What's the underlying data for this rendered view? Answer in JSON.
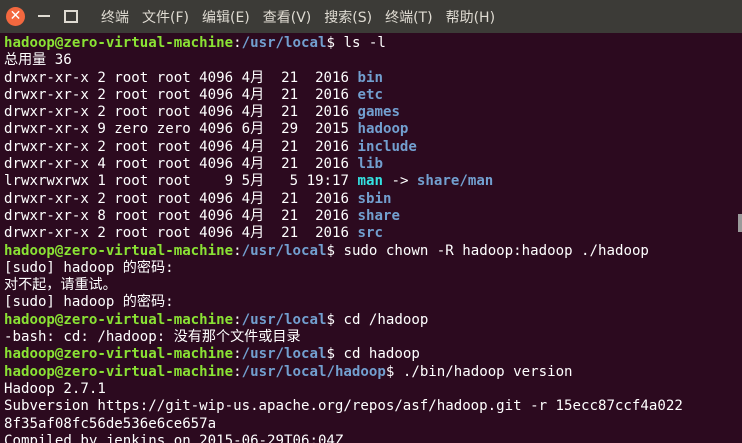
{
  "window": {
    "close_glyph": "✕",
    "menu": [
      "终端",
      "文件(F)",
      "编辑(E)",
      "查看(V)",
      "搜索(S)",
      "终端(T)",
      "帮助(H)"
    ]
  },
  "terminal": {
    "user_host": "hadoop@zero-virtual-machine",
    "colors": {
      "user": "#8ae234",
      "path": "#729fcf",
      "dir": "#729fcf",
      "link": "#34e2e2",
      "bg": "#2c0a1f",
      "fg": "#ffffff"
    },
    "lines": [
      {
        "type": "prompt",
        "path": "/usr/local",
        "cmd": " ls -l"
      },
      {
        "type": "out",
        "text": "总用量 36"
      },
      {
        "type": "ls",
        "meta": "drwxr-xr-x 2 root root 4096 4月  21  2016 ",
        "name": "bin"
      },
      {
        "type": "ls",
        "meta": "drwxr-xr-x 2 root root 4096 4月  21  2016 ",
        "name": "etc"
      },
      {
        "type": "ls",
        "meta": "drwxr-xr-x 2 root root 4096 4月  21  2016 ",
        "name": "games"
      },
      {
        "type": "ls",
        "meta": "drwxr-xr-x 9 zero zero 4096 6月  29  2015 ",
        "name": "hadoop"
      },
      {
        "type": "ls",
        "meta": "drwxr-xr-x 2 root root 4096 4月  21  2016 ",
        "name": "include"
      },
      {
        "type": "ls",
        "meta": "drwxr-xr-x 4 root root 4096 4月  21  2016 ",
        "name": "lib"
      },
      {
        "type": "link",
        "meta": "lrwxrwxrwx 1 root root    9 5月   5 19:17 ",
        "name": "man",
        "arrow": " -> ",
        "target": "share/man"
      },
      {
        "type": "ls",
        "meta": "drwxr-xr-x 2 root root 4096 4月  21  2016 ",
        "name": "sbin"
      },
      {
        "type": "ls",
        "meta": "drwxr-xr-x 8 root root 4096 4月  21  2016 ",
        "name": "share"
      },
      {
        "type": "ls",
        "meta": "drwxr-xr-x 2 root root 4096 4月  21  2016 ",
        "name": "src"
      },
      {
        "type": "prompt",
        "path": "/usr/local",
        "cmd": " sudo chown -R hadoop:hadoop ./hadoop"
      },
      {
        "type": "out",
        "text": "[sudo] hadoop 的密码:"
      },
      {
        "type": "out",
        "text": "对不起，请重试。"
      },
      {
        "type": "out",
        "text": "[sudo] hadoop 的密码:"
      },
      {
        "type": "prompt",
        "path": "/usr/local",
        "cmd": " cd /hadoop"
      },
      {
        "type": "out",
        "text": "-bash: cd: /hadoop: 没有那个文件或目录"
      },
      {
        "type": "prompt",
        "path": "/usr/local",
        "cmd": " cd hadoop"
      },
      {
        "type": "prompt",
        "path": "/usr/local/hadoop",
        "cmd": " ./bin/hadoop version"
      },
      {
        "type": "out",
        "text": "Hadoop 2.7.1"
      },
      {
        "type": "out",
        "text": "Subversion https://git-wip-us.apache.org/repos/asf/hadoop.git -r 15ecc87ccf4a022"
      },
      {
        "type": "out",
        "text": "8f35af08fc56de536e6ce657a"
      },
      {
        "type": "out",
        "text": "Compiled by jenkins on 2015-06-29T06:04Z"
      }
    ]
  }
}
